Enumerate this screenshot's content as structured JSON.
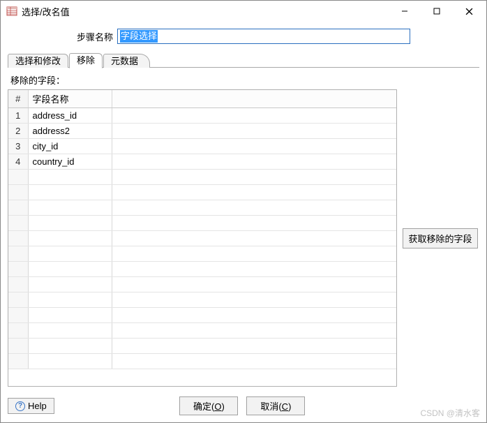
{
  "window": {
    "title": "选择/改名值"
  },
  "form": {
    "step_label": "步骤名称",
    "step_value": "字段选择"
  },
  "tabs": [
    {
      "label": "选择和修改",
      "active": false
    },
    {
      "label": "移除",
      "active": true
    },
    {
      "label": "元数据",
      "active": false
    }
  ],
  "section": {
    "heading": "移除的字段："
  },
  "grid": {
    "columns": {
      "num": "#",
      "field_name": "字段名称"
    },
    "rows": [
      {
        "n": "1",
        "name": "address_id"
      },
      {
        "n": "2",
        "name": "address2"
      },
      {
        "n": "3",
        "name": "city_id"
      },
      {
        "n": "4",
        "name": "country_id"
      }
    ]
  },
  "buttons": {
    "fetch_remove": "获取移除的字段",
    "ok_prefix": "确定(",
    "ok_accel": "O",
    "ok_suffix": ")",
    "cancel_prefix": "取消(",
    "cancel_accel": "C",
    "cancel_suffix": ")",
    "help": "Help"
  },
  "watermarks": {
    "bottom": "CSDN @清水客",
    "side": ""
  }
}
